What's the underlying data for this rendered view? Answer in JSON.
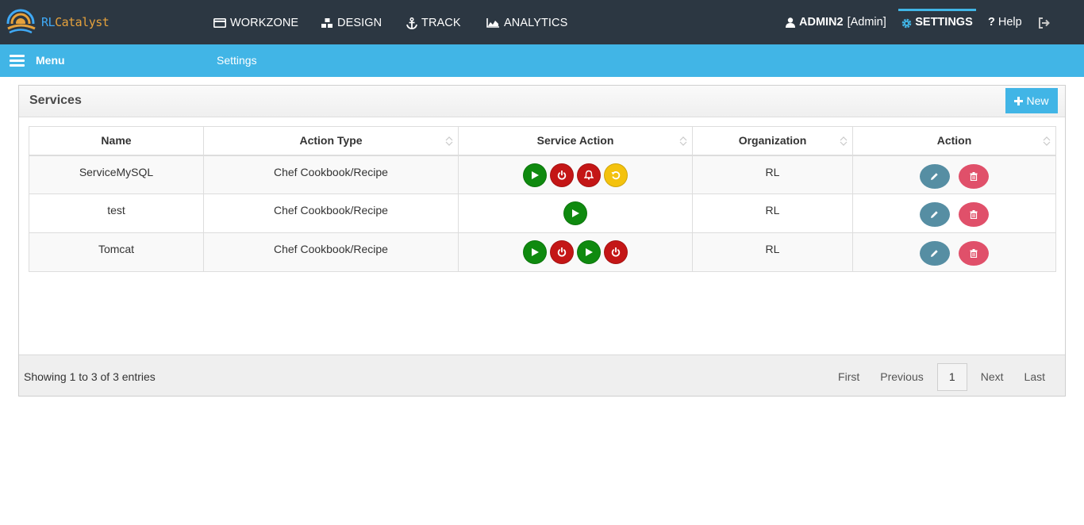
{
  "brand": {
    "name_part1": "RL",
    "name_part2": "Catalyst",
    "colors": {
      "blue": "#3fa9f5",
      "orange": "#e6a23c"
    }
  },
  "nav": {
    "items": [
      {
        "label": "WORKZONE",
        "icon": "workzone-icon"
      },
      {
        "label": "DESIGN",
        "icon": "design-icon"
      },
      {
        "label": "TRACK",
        "icon": "anchor-icon"
      },
      {
        "label": "ANALYTICS",
        "icon": "chart-icon"
      }
    ],
    "user_name": "ADMIN2",
    "user_role": "[Admin]",
    "settings_label": "SETTINGS",
    "help_label": "Help"
  },
  "subbar": {
    "menu_label": "Menu",
    "breadcrumb": "Settings"
  },
  "panel": {
    "title": "Services",
    "new_label": "New"
  },
  "table": {
    "columns": [
      "Name",
      "Action Type",
      "Service Action",
      "Organization",
      "Action"
    ],
    "rows": [
      {
        "name": "ServiceMySQL",
        "action_type": "Chef Cookbook/Recipe",
        "service_actions": [
          "start",
          "stop",
          "alert",
          "restart"
        ],
        "organization": "RL"
      },
      {
        "name": "test",
        "action_type": "Chef Cookbook/Recipe",
        "service_actions": [
          "start"
        ],
        "organization": "RL"
      },
      {
        "name": "Tomcat",
        "action_type": "Chef Cookbook/Recipe",
        "service_actions": [
          "start",
          "stop",
          "start",
          "stop"
        ],
        "organization": "RL"
      }
    ]
  },
  "footer": {
    "entries_text": "Showing 1 to 3 of 3 entries",
    "pager": {
      "first": "First",
      "previous": "Previous",
      "current": "1",
      "next": "Next",
      "last": "Last"
    }
  },
  "colors": {
    "topbar": "#2c3742",
    "accent": "#41b5e6",
    "start": "#0f8a0f",
    "stop": "#c41616",
    "restart": "#f4c20d",
    "edit": "#568ea3",
    "delete": "#e0506a"
  }
}
